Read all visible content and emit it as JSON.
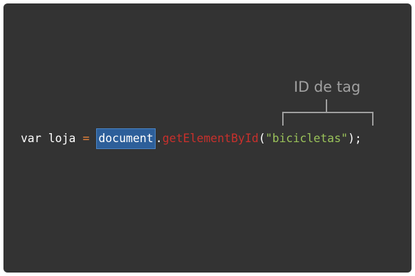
{
  "annotation": {
    "label": "ID de tag"
  },
  "code": {
    "keyword": "var",
    "variable": "loja",
    "operator": "=",
    "object": "document",
    "dot": ".",
    "method": "getElementById",
    "open_paren": "(",
    "argument": "\"bicicletas\"",
    "close": ");"
  },
  "colors": {
    "background": "#333333",
    "highlight": "#2d5f9a",
    "method": "#c9302c",
    "string": "#9ac25a",
    "operator": "#e8833a",
    "annotation": "#a0a0a0"
  }
}
